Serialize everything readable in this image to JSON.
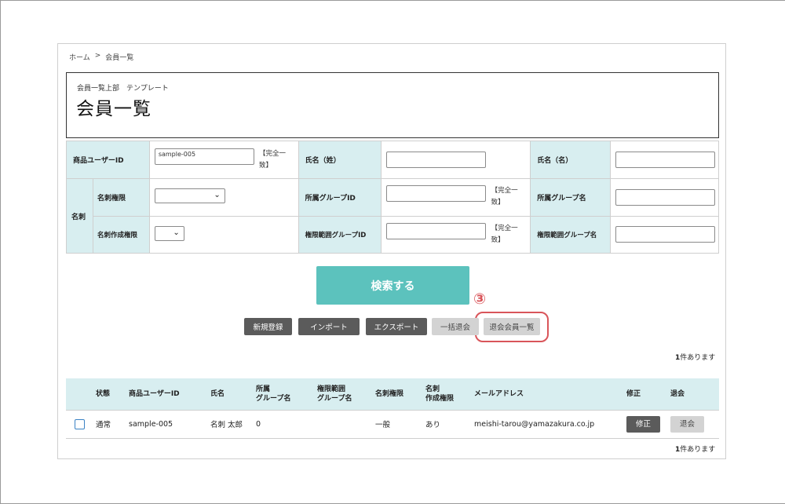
{
  "breadcrumb": {
    "home": "ホーム",
    "sep": ">",
    "current": "会員一覧"
  },
  "header": {
    "sub": "会員一覧上部　テンプレート",
    "title": "会員一覧"
  },
  "search_form": {
    "product_user_id": {
      "label": "商品ユーザーID",
      "value": "sample-005",
      "note": "【完全一致】"
    },
    "last_name": {
      "label": "氏名（姓）",
      "value": ""
    },
    "first_name": {
      "label": "氏名（名）",
      "value": ""
    },
    "card_group_label": "名刺",
    "card_permission": {
      "label": "名刺権限",
      "value": ""
    },
    "belong_group_id": {
      "label": "所属グループID",
      "value": "",
      "note": "【完全一致】"
    },
    "belong_group_name": {
      "label": "所属グループ名",
      "value": ""
    },
    "card_create_permission": {
      "label": "名刺作成権限",
      "value": ""
    },
    "permission_range_group_id": {
      "label": "権限範囲グループID",
      "value": "",
      "note": "【完全一致】"
    },
    "permission_range_group_name": {
      "label": "権限範囲グループ名",
      "value": ""
    }
  },
  "search_button": "検索する",
  "annotation": "③",
  "actions": {
    "new": "新規登録",
    "import": "インポート",
    "export": "エクスポート",
    "bulk_withdraw": "一括退会",
    "withdrawn_list": "退会会員一覧"
  },
  "result_count": {
    "number": "1",
    "unit": "件あります"
  },
  "table": {
    "headers": {
      "status": "状態",
      "product_user_id": "商品ユーザーID",
      "name": "氏名",
      "belong_line1": "所属",
      "belong_line2": "グループ名",
      "range_line1": "権限範囲",
      "range_line2": "グループ名",
      "card_permission": "名刺権限",
      "card_create_line1": "名刺",
      "card_create_line2": "作成権限",
      "email": "メールアドレス",
      "edit": "修正",
      "withdraw": "退会"
    },
    "rows": [
      {
        "status": "通常",
        "product_user_id": "sample-005",
        "name": "名刺 太郎",
        "belong_group": "0",
        "range_group": "",
        "card_permission": "一般",
        "card_create_permission": "あり",
        "email": "meishi-tarou@yamazakura.co.jp",
        "edit_label": "修正",
        "withdraw_label": "退会"
      }
    ]
  },
  "colors": {
    "accent": "#5cc2bd",
    "label_bg": "#d8eef0",
    "highlight": "#d9555a",
    "checkbox": "#3b82c4"
  }
}
